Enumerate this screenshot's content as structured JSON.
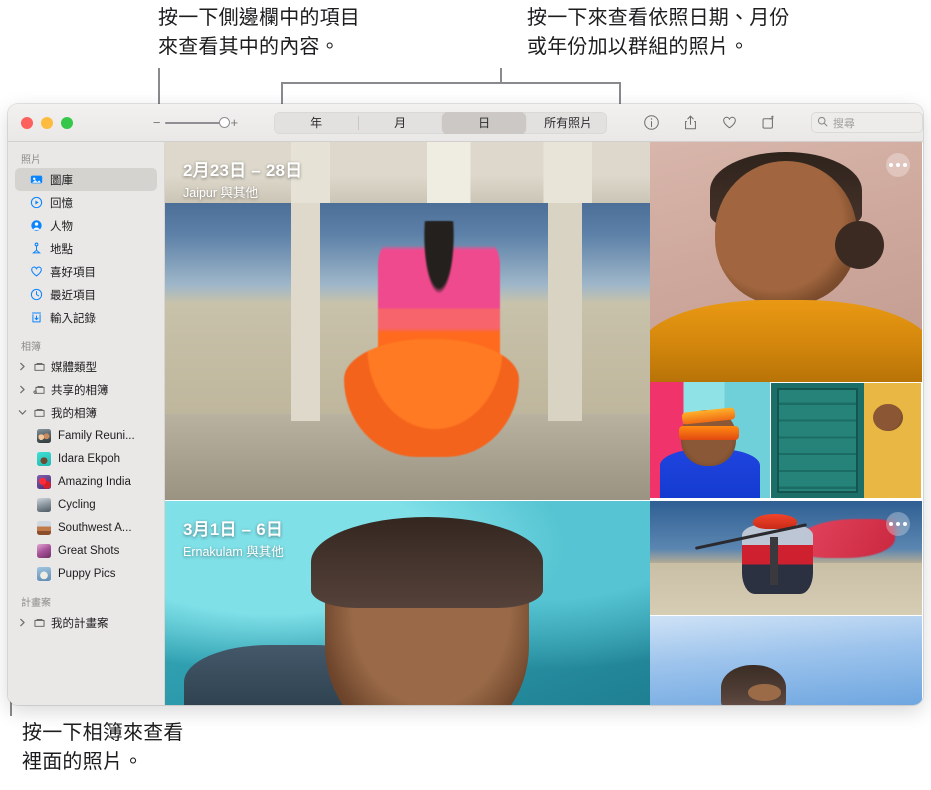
{
  "callouts": {
    "top_left": "按一下側邊欄中的項目\n來查看其中的內容。",
    "top_right": "按一下來查看依照日期、月份\n或年份加以群組的照片。",
    "bottom": "按一下相簿來查看\n裡面的照片。"
  },
  "window": {
    "traffic_lights": {
      "close_color": "#fc615d",
      "minimize_color": "#fdbc40",
      "zoom_color": "#34c749"
    }
  },
  "toolbar": {
    "zoom_out_label": "−",
    "zoom_in_label": "+",
    "segments": [
      {
        "label": "年",
        "active": false
      },
      {
        "label": "月",
        "active": false
      },
      {
        "label": "日",
        "active": true
      },
      {
        "label": "所有照片",
        "active": false
      }
    ],
    "icons": [
      {
        "name": "info-icon"
      },
      {
        "name": "share-icon"
      },
      {
        "name": "favorite-heart-icon"
      },
      {
        "name": "rotate-icon"
      }
    ],
    "search": {
      "placeholder": "搜尋",
      "value": ""
    }
  },
  "sidebar": {
    "sections": [
      {
        "title": "照片",
        "items": [
          {
            "label": "圖庫",
            "icon": "library-icon",
            "selected": true
          },
          {
            "label": "回憶",
            "icon": "memories-icon",
            "selected": false
          },
          {
            "label": "人物",
            "icon": "people-icon",
            "selected": false
          },
          {
            "label": "地點",
            "icon": "places-icon",
            "selected": false
          },
          {
            "label": "喜好項目",
            "icon": "heart-icon",
            "selected": false
          },
          {
            "label": "最近項目",
            "icon": "clock-icon",
            "selected": false
          },
          {
            "label": "輸入記錄",
            "icon": "import-icon",
            "selected": false
          }
        ]
      },
      {
        "title": "相簿",
        "groups": [
          {
            "label": "媒體類型",
            "icon": "folder-icon",
            "expanded": false
          },
          {
            "label": "共享的相簿",
            "icon": "shared-folder-icon",
            "expanded": false
          },
          {
            "label": "我的相簿",
            "icon": "folder-icon",
            "expanded": true,
            "children": [
              {
                "label": "Family Reuni...",
                "thumb": "th-family"
              },
              {
                "label": "Idara Ekpoh",
                "thumb": "th-idara"
              },
              {
                "label": "Amazing India",
                "thumb": "th-amazing"
              },
              {
                "label": "Cycling",
                "thumb": "th-cycling"
              },
              {
                "label": "Southwest A...",
                "thumb": "th-southwest"
              },
              {
                "label": "Great Shots",
                "thumb": "th-greatshots"
              },
              {
                "label": "Puppy Pics",
                "thumb": "th-puppy"
              }
            ]
          }
        ]
      },
      {
        "title": "計畫案",
        "groups": [
          {
            "label": "我的計畫案",
            "icon": "folder-icon",
            "expanded": false
          }
        ]
      }
    ]
  },
  "grid": {
    "groups": [
      {
        "date": "2月23日 – 28日",
        "place": "Jaipur 與其他",
        "more_button": true
      },
      {
        "date": "3月1日 – 6日",
        "place": "Ernakulam 與其他",
        "more_button": true
      }
    ]
  }
}
